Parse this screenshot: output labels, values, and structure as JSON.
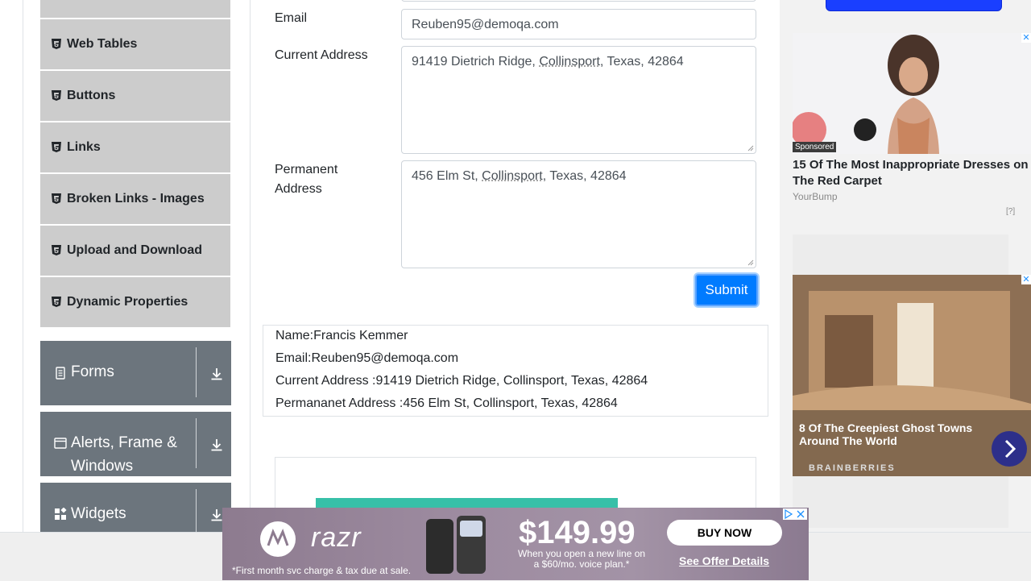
{
  "sidebar": {
    "elements_items": [
      {
        "label": "Web Tables"
      },
      {
        "label": "Buttons"
      },
      {
        "label": "Links"
      },
      {
        "label": "Broken Links - Images"
      },
      {
        "label": "Upload and Download"
      },
      {
        "label": "Dynamic Properties"
      }
    ],
    "groups": [
      {
        "label": "Forms"
      },
      {
        "label": "Alerts, Frame & Windows"
      },
      {
        "label": "Widgets"
      }
    ]
  },
  "form": {
    "email_label": "Email",
    "email_value": "Reuben95@demoqa.com",
    "current_address_label": "Current Address",
    "current_address_value": [
      "91419 Dietrich Ridge, ",
      "Collinsport",
      ", Texas, 42864"
    ],
    "permanent_address_label_1": "Permanent",
    "permanent_address_label_2": "Address",
    "permanent_address_value": [
      "456 Elm St, ",
      "Collinsport",
      ", Texas, 42864"
    ],
    "submit_label": "Submit"
  },
  "output": {
    "name": "Name:Francis Kemmer",
    "email": "Email:Reuben95@demoqa.com",
    "current_address": "Current Address :91419 Dietrich Ridge, Collinsport, Texas, 42864",
    "permanent_address": "Permananet Address :456 Elm St, Collinsport, Texas, 42864"
  },
  "ads": {
    "right_top": {
      "sponsored": "Sponsored",
      "title": "15 Of The Most Inappropriate Dresses on The Red Carpet",
      "source": "YourBump",
      "meta": "[?]"
    },
    "right_mid": {
      "title": "8 Of The Creepiest Ghost Towns Around The World",
      "brand": "BRAINBERRIES"
    },
    "bottom": {
      "brand": "razr",
      "price": "$149.99",
      "price_note": "When you open a new line on a $60/mo. voice plan.*",
      "buy": "BUY NOW",
      "offer": "See Offer Details",
      "fine_print": "*First month svc charge & tax due at sale."
    }
  },
  "colors": {
    "menu_item_bg": "#cccccc",
    "group_bg": "#6c757d",
    "submit_bg": "#007bff"
  }
}
